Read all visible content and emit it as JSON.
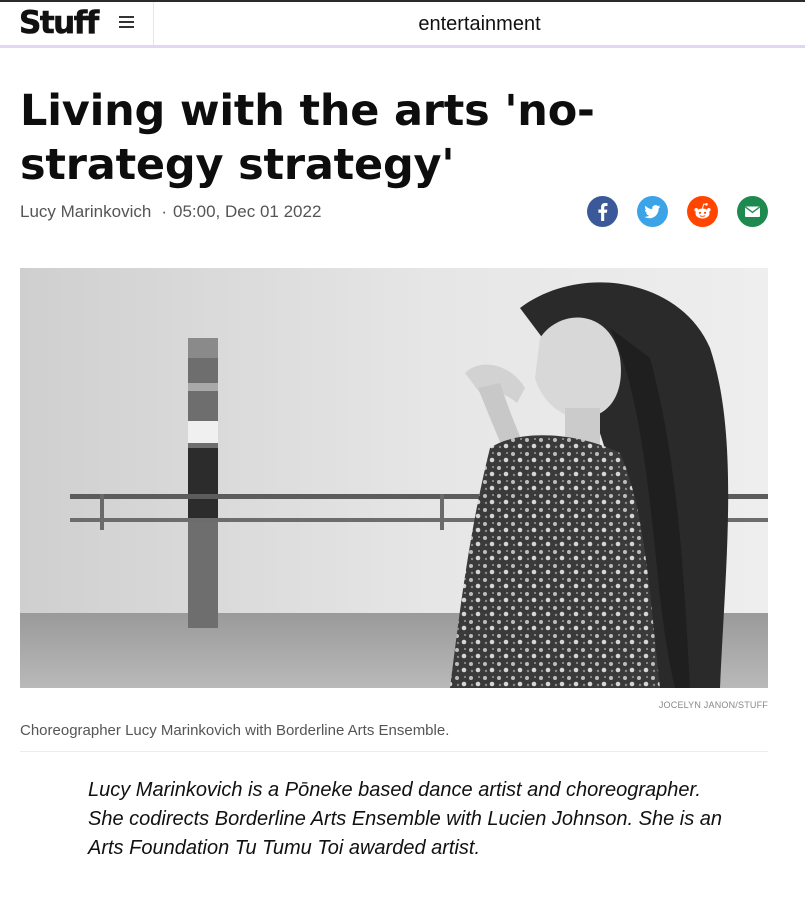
{
  "header": {
    "logo_text": "Stuff",
    "menu_icon": "hamburger-menu-icon",
    "section": "entertainment"
  },
  "article": {
    "headline": "Living with the arts 'no-strategy strategy'",
    "author": "Lucy Marinkovich",
    "separator": "·",
    "published": "05:00, Dec 01 2022",
    "share": [
      {
        "name": "facebook",
        "icon": "facebook-icon",
        "color": "#3b5998"
      },
      {
        "name": "twitter",
        "icon": "twitter-icon",
        "color": "#3ba3e6"
      },
      {
        "name": "reddit",
        "icon": "reddit-icon",
        "color": "#ff4500"
      },
      {
        "name": "email",
        "icon": "email-icon",
        "color": "#1e8a4f"
      }
    ],
    "image_credit": "JOCELYN JANON/STUFF",
    "image_caption": "Choreographer Lucy Marinkovich with Borderline Arts Ensemble.",
    "intro": "Lucy Marinkovich is a Pōneke based dance artist and choreographer. She codirects Borderline Arts Ensemble with Lucien Johnson. She is an Arts Foundation Tu Tumu Toi awarded artist."
  },
  "colors": {
    "header_accent": "#e3d6f3",
    "text_primary": "#111111",
    "text_secondary": "#555555"
  }
}
